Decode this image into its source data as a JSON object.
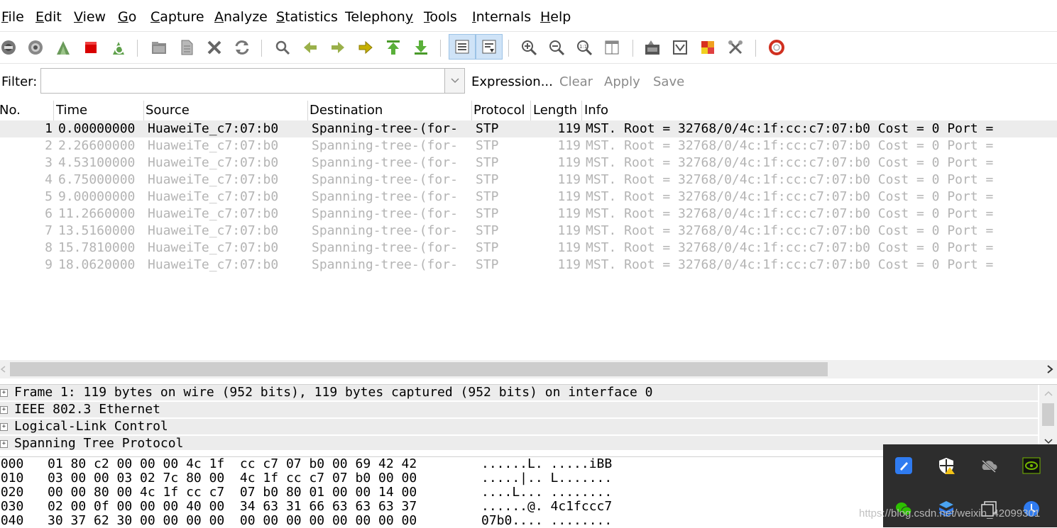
{
  "menu": {
    "file": "ile",
    "file_mn": "F",
    "edit": "dit",
    "edit_mn": "E",
    "view": "iew",
    "view_mn": "V",
    "go": "o",
    "go_mn": "G",
    "capture": "apture",
    "capture_mn": "C",
    "analyze": "nalyze",
    "analyze_mn": "A",
    "statistics": "tatistics",
    "statistics_mn": "S",
    "telephony": "elephon",
    "telephony_mn": "y",
    "telephony_pre": "T",
    "tools": "ools",
    "tools_mn": "T",
    "internals": "nternals",
    "internals_mn": "I",
    "help": "elp",
    "help_mn": "H"
  },
  "toolbar": {
    "icons": [
      "interfaces-icon",
      "options-icon",
      "start-capture-icon",
      "stop-capture-icon",
      "restart-capture-icon",
      "open-file-icon",
      "save-file-icon",
      "close-file-icon",
      "reload-icon",
      "find-packet-icon",
      "go-back-icon",
      "go-forward-icon",
      "go-to-packet-icon",
      "go-first-icon",
      "go-last-icon",
      "colorize-icon",
      "auto-scroll-icon",
      "zoom-in-icon",
      "zoom-out-icon",
      "zoom-normal-icon",
      "resize-columns-icon",
      "capture-filters-icon",
      "display-filters-icon",
      "coloring-rules-icon",
      "preferences-icon",
      "help-icon"
    ]
  },
  "filter": {
    "label": "Filter:",
    "value": "",
    "expression": "Expression...",
    "clear": "Clear",
    "apply": "Apply",
    "save": "Save"
  },
  "columns": [
    "No.",
    "Time",
    "Source",
    "Destination",
    "Protocol",
    "Length",
    "Info"
  ],
  "packets": [
    {
      "no": "1",
      "time": "0.00000000",
      "src": "HuaweiTe_c7:07:b0",
      "dst": "Spanning-tree-(for-",
      "proto": "STP",
      "len": "119",
      "info": "MST. Root = 32768/0/4c:1f:cc:c7:07:b0  Cost = 0  Port ="
    },
    {
      "no": "2",
      "time": "2.26600000",
      "src": "HuaweiTe_c7:07:b0",
      "dst": "Spanning-tree-(for-",
      "proto": "STP",
      "len": "119",
      "info": "MST. Root = 32768/0/4c:1f:cc:c7:07:b0  Cost = 0  Port ="
    },
    {
      "no": "3",
      "time": "4.53100000",
      "src": "HuaweiTe_c7:07:b0",
      "dst": "Spanning-tree-(for-",
      "proto": "STP",
      "len": "119",
      "info": "MST. Root = 32768/0/4c:1f:cc:c7:07:b0  Cost = 0  Port ="
    },
    {
      "no": "4",
      "time": "6.75000000",
      "src": "HuaweiTe_c7:07:b0",
      "dst": "Spanning-tree-(for-",
      "proto": "STP",
      "len": "119",
      "info": "MST. Root = 32768/0/4c:1f:cc:c7:07:b0  Cost = 0  Port ="
    },
    {
      "no": "5",
      "time": "9.00000000",
      "src": "HuaweiTe_c7:07:b0",
      "dst": "Spanning-tree-(for-",
      "proto": "STP",
      "len": "119",
      "info": "MST. Root = 32768/0/4c:1f:cc:c7:07:b0  Cost = 0  Port ="
    },
    {
      "no": "6",
      "time": "11.2660000",
      "src": "HuaweiTe_c7:07:b0",
      "dst": "Spanning-tree-(for-",
      "proto": "STP",
      "len": "119",
      "info": "MST. Root = 32768/0/4c:1f:cc:c7:07:b0  Cost = 0  Port ="
    },
    {
      "no": "7",
      "time": "13.5160000",
      "src": "HuaweiTe_c7:07:b0",
      "dst": "Spanning-tree-(for-",
      "proto": "STP",
      "len": "119",
      "info": "MST. Root = 32768/0/4c:1f:cc:c7:07:b0  Cost = 0  Port ="
    },
    {
      "no": "8",
      "time": "15.7810000",
      "src": "HuaweiTe_c7:07:b0",
      "dst": "Spanning-tree-(for-",
      "proto": "STP",
      "len": "119",
      "info": "MST. Root = 32768/0/4c:1f:cc:c7:07:b0  Cost = 0  Port ="
    },
    {
      "no": "9",
      "time": "18.0620000",
      "src": "HuaweiTe_c7:07:b0",
      "dst": "Spanning-tree-(for-",
      "proto": "STP",
      "len": "119",
      "info": "MST. Root = 32768/0/4c:1f:cc:c7:07:b0  Cost = 0  Port ="
    }
  ],
  "details": [
    "Frame 1: 119 bytes on wire (952 bits), 119 bytes captured (952 bits) on interface 0",
    "IEEE 802.3 Ethernet",
    "Logical-Link Control",
    "Spanning Tree Protocol"
  ],
  "hex": [
    {
      "off": "0000",
      "bytes": "01 80 c2 00 00 00 4c 1f  cc c7 07 b0 00 69 42 42",
      "ascii": "......L. .....iBB"
    },
    {
      "off": "0010",
      "bytes": "03 00 00 03 02 7c 80 00  4c 1f cc c7 07 b0 00 00",
      "ascii": ".....|.. L......."
    },
    {
      "off": "0020",
      "bytes": "00 00 80 00 4c 1f cc c7  07 b0 80 01 00 00 14 00",
      "ascii": "....L... ........"
    },
    {
      "off": "0030",
      "bytes": "02 00 0f 00 00 00 40 00  34 63 31 66 63 63 63 37",
      "ascii": "......@. 4c1fccc7"
    },
    {
      "off": "0040",
      "bytes": "30 37 62 30 00 00 00 00  00 00 00 00 00 00 00 00",
      "ascii": "07b0.... ........"
    }
  ],
  "tray": {
    "icons": [
      "pen-app-icon",
      "security-warning-icon",
      "cloud-offline-icon",
      "nvidia-icon",
      "wechat-icon",
      "package-icon",
      "window-icon",
      "update-icon"
    ]
  },
  "watermark": "https://blog.csdn.net/weixin_42099301"
}
